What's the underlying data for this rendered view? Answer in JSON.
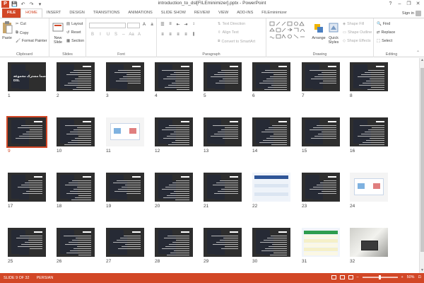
{
  "window": {
    "title": "introduction_to_dsl[FILEminimizer].pptx - PowerPoint",
    "help": "?",
    "minimize": "–",
    "maximize": "❐",
    "close": "✕"
  },
  "qat": {
    "logo": "P",
    "save": "💾",
    "undo": "↶",
    "redo": "↷",
    "customize": "▾"
  },
  "tabs": [
    "FILE",
    "HOME",
    "INSERT",
    "DESIGN",
    "TRANSITIONS",
    "ANIMATIONS",
    "SLIDE SHOW",
    "REVIEW",
    "VIEW",
    "ADD-INS",
    "FILEminimizer"
  ],
  "active_tab": "HOME",
  "sign_in": "Sign in",
  "ribbon": {
    "clipboard": {
      "label": "Clipboard",
      "paste": "Paste",
      "cut": "Cut",
      "copy": "Copy",
      "format_painter": "Format Painter"
    },
    "slides": {
      "label": "Slides",
      "new_slide": "New Slide",
      "layout": "Layout",
      "reset": "Reset",
      "section": "Section"
    },
    "font": {
      "label": "Font"
    },
    "paragraph": {
      "label": "Paragraph",
      "text_direction": "Text Direction",
      "align_text": "Align Text",
      "convert_smartart": "Convert to SmartArt"
    },
    "drawing": {
      "label": "Drawing",
      "arrange": "Arrange",
      "quick_styles": "Quick Styles",
      "shape_fill": "Shape Fill",
      "shape_outline": "Shape Outline",
      "shape_effects": "Shape Effects"
    },
    "editing": {
      "label": "Editing",
      "find": "Find",
      "replace": "Replace",
      "select": "Select"
    }
  },
  "slides": {
    "selected": 9,
    "cover_text": "شما مشترک مجموعه DSL",
    "numbers": [
      "1",
      "2",
      "3",
      "4",
      "5",
      "6",
      "7",
      "8",
      "9",
      "10",
      "11",
      "12",
      "13",
      "14",
      "15",
      "16",
      "17",
      "18",
      "19",
      "20",
      "21",
      "22",
      "23",
      "24",
      "25",
      "26",
      "27",
      "28",
      "29",
      "30",
      "31",
      "32"
    ],
    "special": {
      "1": "cover",
      "11": "light",
      "22": "table",
      "24": "light",
      "31": "table",
      "32": "photo"
    }
  },
  "status": {
    "slide_info": "SLIDE 9 OF 32",
    "language": "PERSIAN",
    "zoom": "50%",
    "zoom_fraction": 0.5
  },
  "colors": {
    "accent": "#d24726",
    "slide_bg": "#2e2e2e"
  }
}
